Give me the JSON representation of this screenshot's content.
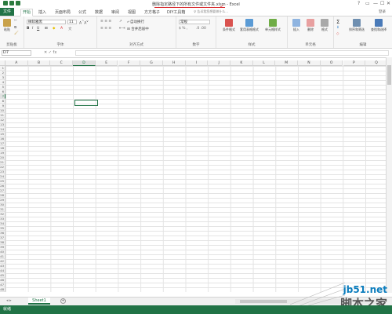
{
  "window": {
    "title": "删除指定路径下的所有文件或文件夹.xlsm - Excel",
    "controls": [
      "?",
      "▭",
      "—",
      "☐",
      "✕"
    ]
  },
  "tabs": [
    {
      "label": "文件",
      "kind": "file"
    },
    {
      "label": "开始",
      "kind": "active"
    },
    {
      "label": "插入"
    },
    {
      "label": "页面布局"
    },
    {
      "label": "公式"
    },
    {
      "label": "数据"
    },
    {
      "label": "审阅"
    },
    {
      "label": "视图"
    },
    {
      "label": "方方格子"
    },
    {
      "label": "DIY工具箱"
    }
  ],
  "tellme": "告诉我您想要做什么...",
  "login": "登录",
  "ribbon": {
    "clipboard": {
      "name": "剪贴板",
      "paste": "粘贴"
    },
    "font": {
      "name": "字体",
      "font_name": "微软雅黑",
      "font_size": "11",
      "bold": "B",
      "italic": "I",
      "underline": "U"
    },
    "alignment": {
      "name": "对齐方式",
      "wrap": "自动换行",
      "merge": "合并后居中"
    },
    "number": {
      "name": "数字",
      "format": "常规"
    },
    "styles": {
      "name": "样式",
      "conditional": "条件格式",
      "table": "套用表格格式",
      "cell": "单元格样式"
    },
    "cells": {
      "name": "单元格",
      "insert": "插入",
      "delete": "删除",
      "format": "格式"
    },
    "editing": {
      "name": "编辑",
      "sort": "排序和筛选",
      "find": "查找和选择"
    }
  },
  "formula": {
    "name_box": "D7",
    "icons": "✕  ✓  fx",
    "value": ""
  },
  "grid": {
    "columns": [
      "A",
      "B",
      "C",
      "D",
      "E",
      "F",
      "G",
      "H",
      "I",
      "J",
      "K",
      "L",
      "M",
      "N",
      "O",
      "P",
      "Q"
    ],
    "selected_column": "D",
    "row_count": 48,
    "selected_row": 7
  },
  "sheets": [
    {
      "label": "Sheet1",
      "active": true
    }
  ],
  "add_sheet": "+",
  "status": {
    "ready": "就绪"
  },
  "watermark": {
    "line1": "jb51.net",
    "line2": "脚本之家"
  }
}
